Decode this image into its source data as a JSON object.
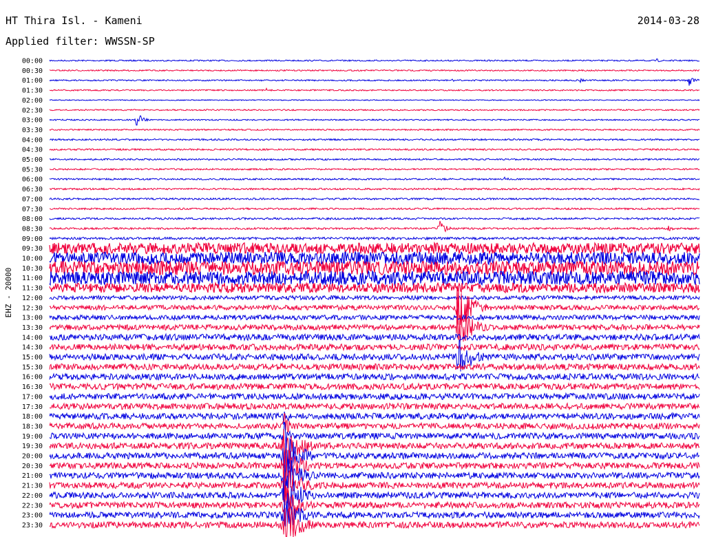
{
  "header": {
    "station": "HT Thira Isl. - Kameni",
    "date": "2014-03-28",
    "filter": "Applied filter: WWSSN-SP"
  },
  "chart_data": {
    "type": "line",
    "title": "HT Thira Isl. - Kameni",
    "ylabel": "EHZ - 20000",
    "colors": [
      "#0000e0",
      "#f0003c"
    ],
    "rows": [
      "00:00",
      "00:30",
      "01:00",
      "01:30",
      "02:00",
      "02:30",
      "03:00",
      "03:30",
      "04:00",
      "04:30",
      "05:00",
      "05:30",
      "06:00",
      "06:30",
      "07:00",
      "07:30",
      "08:00",
      "08:30",
      "09:00",
      "09:30",
      "10:00",
      "10:30",
      "11:00",
      "11:30",
      "12:00",
      "12:30",
      "13:00",
      "13:30",
      "14:00",
      "14:30",
      "15:00",
      "15:30",
      "16:00",
      "16:30",
      "17:00",
      "17:30",
      "18:00",
      "18:30",
      "19:00",
      "19:30",
      "20:00",
      "20:30",
      "21:00",
      "21:30",
      "22:00",
      "22:30",
      "23:00",
      "23:30"
    ],
    "noise_level": [
      1,
      1,
      1,
      1,
      0.7,
      1,
      1,
      1,
      1.2,
      1.2,
      1.2,
      1.2,
      1.2,
      1.3,
      1.3,
      1.3,
      1.4,
      1.4,
      1.8,
      8,
      9,
      10,
      10,
      7,
      3,
      3.5,
      3.5,
      4,
      4.5,
      4.5,
      4.5,
      4.5,
      4.5,
      4.5,
      4.5,
      4.5,
      4.5,
      4.5,
      4.5,
      4.5,
      4.5,
      4.5,
      4.5,
      4.5,
      4.5,
      4.5,
      4.5,
      4.5
    ],
    "events": [
      {
        "row": "00:00",
        "minute": 28,
        "amplitude": 3
      },
      {
        "row": "00:30",
        "minute": 16,
        "amplitude": 2
      },
      {
        "row": "01:00",
        "minute": 18.5,
        "amplitude": 3
      },
      {
        "row": "01:00",
        "minute": 24.5,
        "amplitude": 3
      },
      {
        "row": "01:00",
        "minute": 29.5,
        "amplitude": 10
      },
      {
        "row": "01:30",
        "minute": 10,
        "amplitude": 3
      },
      {
        "row": "03:00",
        "minute": 4,
        "amplitude": 14
      },
      {
        "row": "06:00",
        "minute": 21,
        "amplitude": 3
      },
      {
        "row": "08:30",
        "minute": 18,
        "amplitude": 14
      },
      {
        "row": "08:30",
        "minute": 28.5,
        "amplitude": 6
      },
      {
        "row": "12:30",
        "minute": 18.8,
        "amplitude": 40
      },
      {
        "row": "13:30",
        "minute": 18.8,
        "amplitude": 36
      },
      {
        "row": "15:00",
        "minute": 18.8,
        "amplitude": 34
      },
      {
        "row": "18:00",
        "minute": 10.8,
        "amplitude": 16
      },
      {
        "row": "18:30",
        "minute": 10.8,
        "amplitude": 22
      },
      {
        "row": "19:00",
        "minute": 10.8,
        "amplitude": 28
      },
      {
        "row": "19:30",
        "minute": 10.8,
        "amplitude": 40
      },
      {
        "row": "20:00",
        "minute": 10.8,
        "amplitude": 40
      },
      {
        "row": "20:30",
        "minute": 10.8,
        "amplitude": 40
      },
      {
        "row": "21:00",
        "minute": 10.8,
        "amplitude": 40
      },
      {
        "row": "21:30",
        "minute": 10.8,
        "amplitude": 40
      },
      {
        "row": "22:00",
        "minute": 10.8,
        "amplitude": 40
      },
      {
        "row": "22:30",
        "minute": 10.8,
        "amplitude": 34
      },
      {
        "row": "23:00",
        "minute": 10.8,
        "amplitude": 34
      },
      {
        "row": "23:30",
        "minute": 10.8,
        "amplitude": 40
      }
    ],
    "x_range_minutes": [
      0,
      30
    ]
  }
}
